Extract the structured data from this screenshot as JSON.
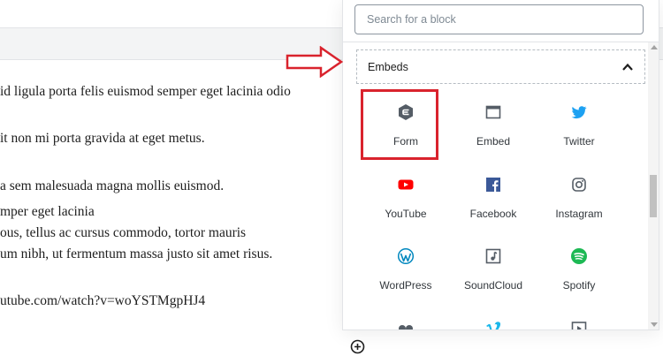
{
  "editor": {
    "lines": [
      {
        "text": "id ligula porta felis euismod semper eget lacinia odio"
      },
      {
        "text": "it non mi porta gravida at eget metus."
      },
      {
        "text": "a sem malesuada magna mollis euismod."
      },
      {
        "text": "mper eget lacinia"
      },
      {
        "text": "ous, tellus ac cursus commodo, tortor mauris"
      },
      {
        "text": "um nibh, ut fermentum massa justo sit amet risus."
      },
      {
        "text": "utube.com/watch?v=woYSTMgpHJ4"
      }
    ]
  },
  "inserter": {
    "search_placeholder": "Search for a block",
    "panel_title": "Embeds",
    "blocks": [
      {
        "label": "Form",
        "icon": "form-hexagon-icon",
        "color": "#555d66"
      },
      {
        "label": "Embed",
        "icon": "embed-window-icon",
        "color": "#555d66"
      },
      {
        "label": "Twitter",
        "icon": "twitter-icon",
        "color": "#1da1f2"
      },
      {
        "label": "YouTube",
        "icon": "youtube-icon",
        "color": "#ff0000"
      },
      {
        "label": "Facebook",
        "icon": "facebook-icon",
        "color": "#3b5998"
      },
      {
        "label": "Instagram",
        "icon": "instagram-icon",
        "color": "#555d66"
      },
      {
        "label": "WordPress",
        "icon": "wordpress-icon",
        "color": "#0087be"
      },
      {
        "label": "SoundCloud",
        "icon": "soundcloud-note-icon",
        "color": "#555d66"
      },
      {
        "label": "Spotify",
        "icon": "spotify-icon",
        "color": "#1db954"
      },
      {
        "label": "",
        "icon": "flickr-icon",
        "color": "#555d66"
      },
      {
        "label": "",
        "icon": "vimeo-icon",
        "color": "#1ab7ea"
      },
      {
        "label": "",
        "icon": "video-play-icon",
        "color": "#555d66"
      }
    ]
  },
  "annotations": {
    "highlight_color": "#d9232d"
  }
}
